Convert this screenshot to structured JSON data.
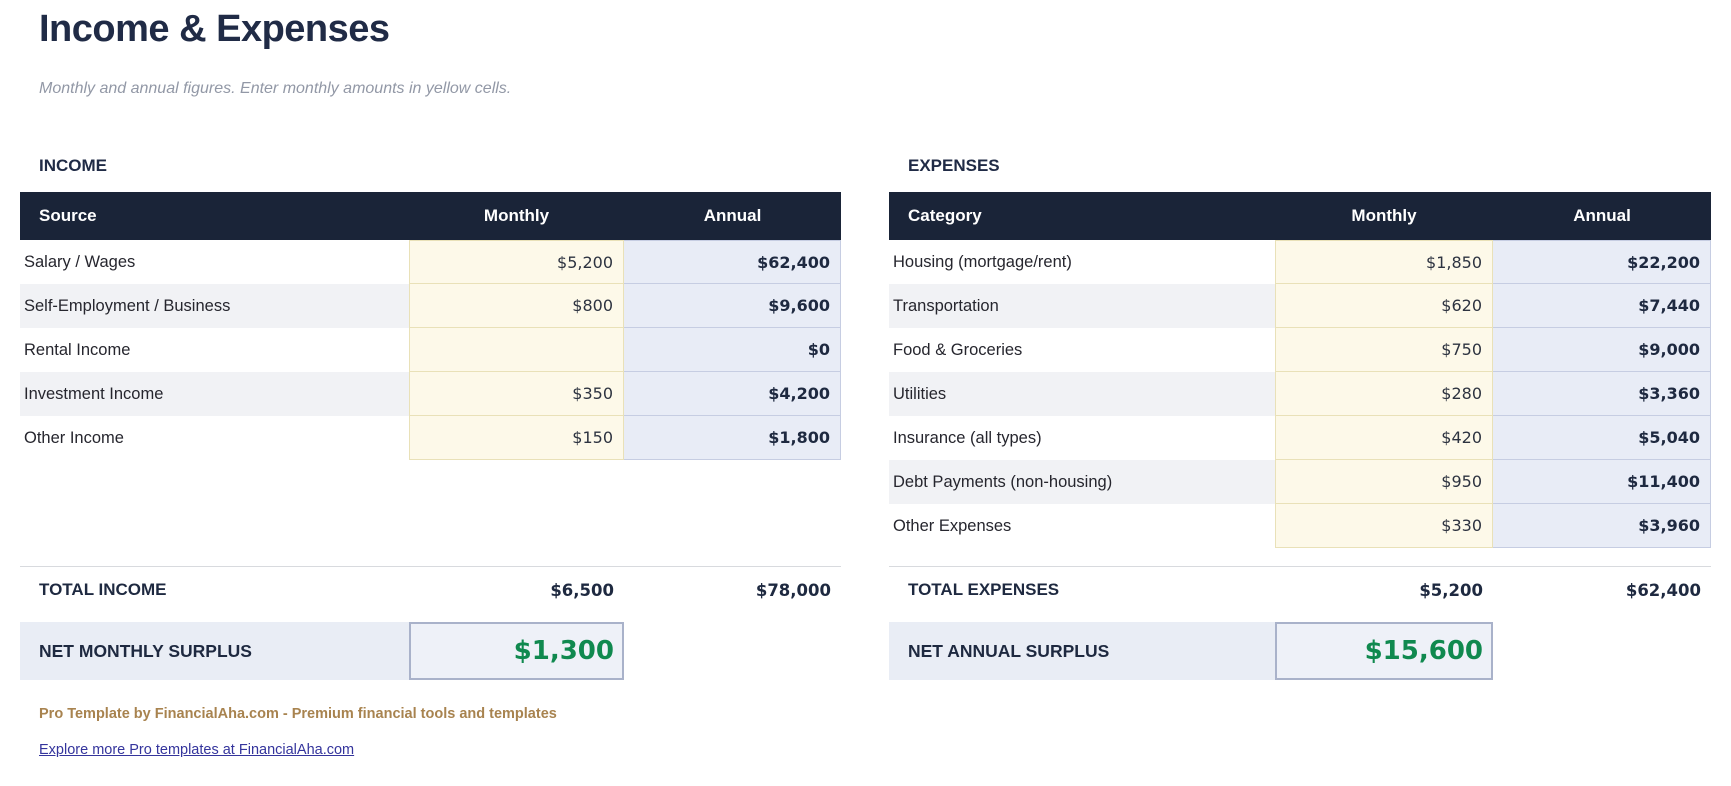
{
  "page": {
    "title": "Income & Expenses",
    "subtitle": "Monthly and annual figures. Enter monthly amounts in yellow cells."
  },
  "income": {
    "section_label": "INCOME",
    "headers": {
      "label": "Source",
      "monthly": "Monthly",
      "annual": "Annual"
    },
    "rows": [
      {
        "label": "Salary / Wages",
        "monthly": "$5,200",
        "annual": "$62,400"
      },
      {
        "label": "Self-Employment / Business",
        "monthly": "$800",
        "annual": "$9,600"
      },
      {
        "label": "Rental Income",
        "monthly": "",
        "annual": "$0"
      },
      {
        "label": "Investment Income",
        "monthly": "$350",
        "annual": "$4,200"
      },
      {
        "label": "Other Income",
        "monthly": "$150",
        "annual": "$1,800"
      }
    ],
    "total": {
      "label": "TOTAL INCOME",
      "monthly": "$6,500",
      "annual": "$78,000"
    },
    "surplus": {
      "label": "NET MONTHLY SURPLUS",
      "value": "$1,300"
    }
  },
  "expenses": {
    "section_label": "EXPENSES",
    "headers": {
      "label": "Category",
      "monthly": "Monthly",
      "annual": "Annual"
    },
    "rows": [
      {
        "label": "Housing (mortgage/rent)",
        "monthly": "$1,850",
        "annual": "$22,200"
      },
      {
        "label": "Transportation",
        "monthly": "$620",
        "annual": "$7,440"
      },
      {
        "label": "Food & Groceries",
        "monthly": "$750",
        "annual": "$9,000"
      },
      {
        "label": "Utilities",
        "monthly": "$280",
        "annual": "$3,360"
      },
      {
        "label": "Insurance (all types)",
        "monthly": "$420",
        "annual": "$5,040"
      },
      {
        "label": "Debt Payments (non-housing)",
        "monthly": "$950",
        "annual": "$11,400"
      },
      {
        "label": "Other Expenses",
        "monthly": "$330",
        "annual": "$3,960"
      }
    ],
    "total": {
      "label": "TOTAL EXPENSES",
      "monthly": "$5,200",
      "annual": "$62,400"
    },
    "surplus": {
      "label": "NET ANNUAL SURPLUS",
      "value": "$15,600"
    }
  },
  "footer": {
    "branding": "Pro Template by FinancialAha.com - Premium financial tools and templates",
    "link_text": "Explore more Pro templates at FinancialAha.com"
  },
  "colors": {
    "header-bg": "#1a2438",
    "accent-navy": "#202b46",
    "input-yellow": "#fdf9e9",
    "input-yellow-border": "#e9e1b8",
    "computed-blue": "#e8ecf6",
    "computed-blue-border": "#c6cde2",
    "stripe-gray": "#f1f2f5",
    "surplus-bg": "#e9edf5",
    "surplus-green": "#10894f",
    "brand-tan": "#a8834f",
    "link-blue": "#34349c"
  }
}
